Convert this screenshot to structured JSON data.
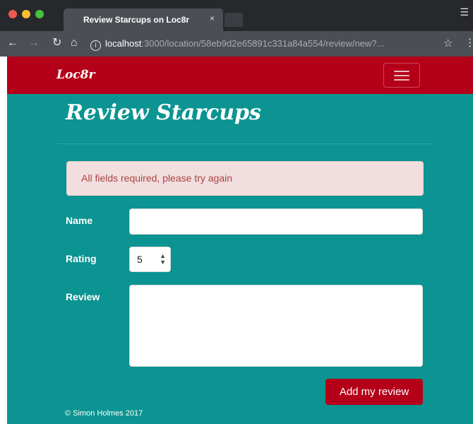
{
  "browser": {
    "tab_title": "Review Starcups on Loc8r",
    "tab_close": "×",
    "url_host": "localhost",
    "url_rest": ":3000/location/58eb9d2e65891c331a84a554/review/new?...",
    "icons": {
      "back": "back-arrow-icon",
      "forward": "forward-arrow-icon",
      "reload": "reload-icon",
      "home": "home-icon",
      "info": "info-icon",
      "bookmark": "star-icon",
      "menu": "kebab-menu-icon"
    }
  },
  "navbar": {
    "brand": "Loc8r",
    "menu_icon": "hamburger-icon",
    "color": "#b40019"
  },
  "page": {
    "title": "Review Starcups",
    "background": "#0b9491"
  },
  "alert": {
    "message": "All fields required, please try again"
  },
  "form": {
    "name_label": "Name",
    "name_value": "",
    "rating_label": "Rating",
    "rating_value": "5",
    "review_label": "Review",
    "review_value": "",
    "submit_label": "Add my review"
  },
  "footer": {
    "text": "© Simon Holmes 2017"
  }
}
